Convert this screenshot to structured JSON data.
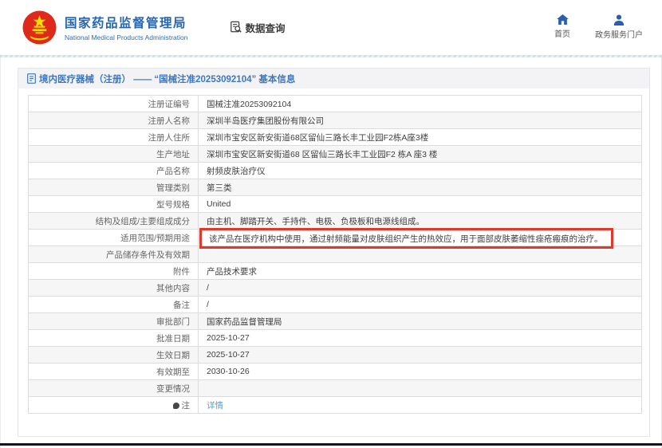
{
  "colors": {
    "brand_blue": "#2566af",
    "nav_icon_blue": "#2b5fae",
    "title_blue": "#3a78c3",
    "link_blue": "#5b9bd5",
    "annotation_red": "#e0392b",
    "emblem_red": "#dd2a1b",
    "emblem_gold": "#ffde00"
  },
  "header": {
    "org_name": "国家药品监督管理局",
    "org_name_en": "National Medical Products Administration",
    "data_query_label": "数据查询",
    "nav": [
      {
        "label": "首页",
        "icon": "home-icon"
      },
      {
        "label": "政务服务门户",
        "icon": "person-icon"
      }
    ]
  },
  "panel": {
    "title": "境内医疗器械（注册） —— “国械注准20253092104” 基本信息"
  },
  "table": {
    "rows": [
      {
        "label": "注册证编号",
        "value": "国械注准20253092104"
      },
      {
        "label": "注册人名称",
        "value": "深圳半岛医疗集团股份有限公司"
      },
      {
        "label": "注册人住所",
        "value": "深圳市宝安区新安街道68区留仙三路长丰工业园F2栋A座3楼"
      },
      {
        "label": "生产地址",
        "value": "深圳市宝安区新安街道68 区留仙三路长丰工业园F2 栋A 座3 楼"
      },
      {
        "label": "产品名称",
        "value": "射频皮肤治疗仪"
      },
      {
        "label": "管理类别",
        "value": "第三类"
      },
      {
        "label": "型号规格",
        "value": "United"
      },
      {
        "label": "结构及组成/主要组成成分",
        "value": "由主机、脚踏开关、手持件、电极、负极板和电源线组成。"
      },
      {
        "label": "适用范围/预期用途",
        "value": "该产品在医疗机构中使用，通过射频能量对皮肤组织产生的热效应，用于面部皮肤萎缩性痤疮瘢痕的治疗。",
        "highlight": true
      },
      {
        "label": "产品储存条件及有效期",
        "value": ""
      },
      {
        "label": "附件",
        "value": "产品技术要求"
      },
      {
        "label": "其他内容",
        "value": "/"
      },
      {
        "label": "备注",
        "value": "/"
      },
      {
        "label": "审批部门",
        "value": "国家药品监督管理局"
      },
      {
        "label": "批准日期",
        "value": "2025-10-27"
      },
      {
        "label": "生效日期",
        "value": "2025-10-27"
      },
      {
        "label": "有效期至",
        "value": "2030-10-26"
      },
      {
        "label": "变更情况",
        "value": ""
      },
      {
        "label": "注",
        "value": "详情",
        "value_type": "link",
        "label_icon": "note-icon"
      }
    ]
  }
}
